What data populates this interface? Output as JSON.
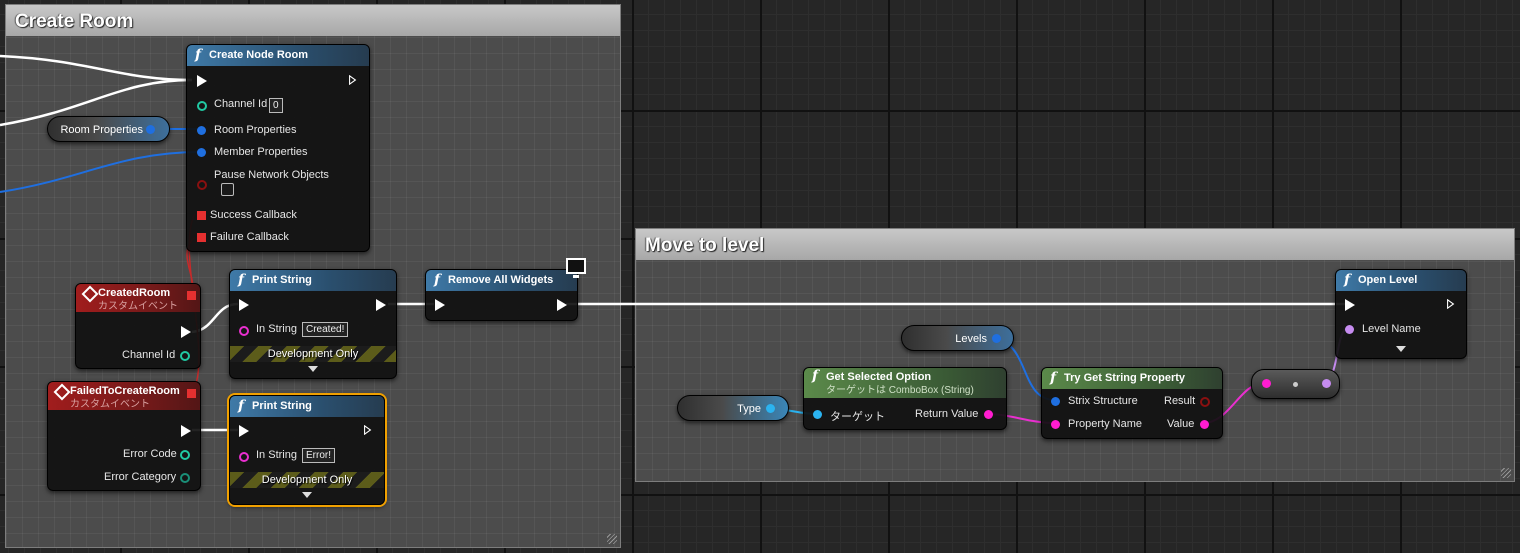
{
  "comments": {
    "create_room": "Create Room",
    "move_to_level": "Move to level"
  },
  "create_node_room": {
    "title": "Create Node Room",
    "channel_id_label": "Channel Id",
    "channel_id_value": "0",
    "room_properties_label": "Room Properties",
    "member_properties_label": "Member Properties",
    "pause_network_objects_label": "Pause Network Objects",
    "success_callback_label": "Success Callback",
    "failure_callback_label": "Failure Callback"
  },
  "room_properties_var": "Room Properties",
  "created_room_event": {
    "title": "CreatedRoom",
    "subtitle": "カスタムイベント",
    "channel_id_label": "Channel Id"
  },
  "failed_event": {
    "title": "FailedToCreateRoom",
    "subtitle": "カスタムイベント",
    "error_code_label": "Error Code",
    "error_category_label": "Error Category"
  },
  "print_string_1": {
    "title": "Print String",
    "in_string_label": "In String",
    "in_string_value": "Created!",
    "dev_only": "Development Only"
  },
  "print_string_2": {
    "title": "Print String",
    "in_string_label": "In String",
    "in_string_value": "Error!",
    "dev_only": "Development Only"
  },
  "remove_all_widgets": {
    "title": "Remove All Widgets"
  },
  "open_level": {
    "title": "Open Level",
    "level_name_label": "Level Name"
  },
  "levels_var": "Levels",
  "type_var": "Type",
  "get_selected_option": {
    "title": "Get Selected Option",
    "subtitle": "ターゲットは ComboBox (String)",
    "target_label": "ターゲット",
    "return_value_label": "Return Value"
  },
  "try_get_string_property": {
    "title": "Try Get String Property",
    "strix_structure_label": "Strix Structure",
    "property_name_label": "Property Name",
    "result_label": "Result",
    "value_label": "Value"
  },
  "colors": {
    "exec_wire": "#ffffff",
    "struct_wire": "#1f6fe0",
    "string_wire": "#ea2fd0",
    "name_wire": "#c68cf0",
    "event_wire": "#e53030",
    "function_header": "#3f7aa8",
    "event_header": "#a11d1d",
    "pure_header": "#5b8a4a",
    "selection": "#f0a000"
  }
}
